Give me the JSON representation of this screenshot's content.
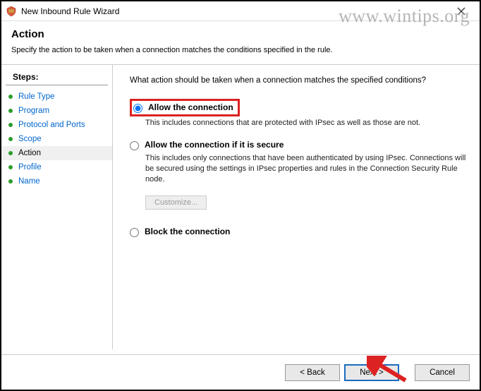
{
  "window": {
    "title": "New Inbound Rule Wizard"
  },
  "header": {
    "heading": "Action",
    "description": "Specify the action to be taken when a connection matches the conditions specified in the rule."
  },
  "sidebar": {
    "title": "Steps:",
    "items": [
      {
        "label": "Rule Type",
        "active": false
      },
      {
        "label": "Program",
        "active": false
      },
      {
        "label": "Protocol and Ports",
        "active": false
      },
      {
        "label": "Scope",
        "active": false
      },
      {
        "label": "Action",
        "active": true
      },
      {
        "label": "Profile",
        "active": false
      },
      {
        "label": "Name",
        "active": false
      }
    ]
  },
  "content": {
    "prompt": "What action should be taken when a connection matches the specified conditions?",
    "options": {
      "allow": {
        "label": "Allow the connection",
        "desc": "This includes connections that are protected with IPsec as well as those are not."
      },
      "allow_secure": {
        "label": "Allow the connection if it is secure",
        "desc": "This includes only connections that have been authenticated by using IPsec. Connections will be secured using the settings in IPsec properties and rules in the Connection Security Rule node."
      },
      "block": {
        "label": "Block the connection"
      }
    },
    "customize_label": "Customize..."
  },
  "footer": {
    "back": "< Back",
    "next": "Next >",
    "cancel": "Cancel"
  },
  "watermark": "www.wintips.org"
}
